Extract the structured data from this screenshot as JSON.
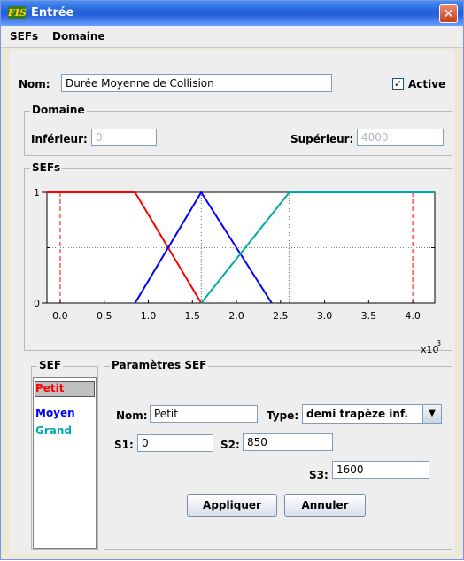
{
  "window": {
    "title": "Entrée",
    "app_icon_text": "FIS"
  },
  "menu": [
    "SEFs",
    "Domaine"
  ],
  "nom": {
    "label": "Nom:",
    "value": "Durée Moyenne de Collision"
  },
  "active": {
    "label": "Active",
    "checked": true
  },
  "domaine": {
    "group_title": "Domaine",
    "inferieur_label": "Inférieur:",
    "inferieur_value": "0",
    "superieur_label": "Supérieur:",
    "superieur_value": "4000"
  },
  "sefs_group_title": "SEFs",
  "chart_data": {
    "type": "line",
    "x_ticks": [
      "0.0",
      "0.5",
      "1.0",
      "1.5",
      "2.0",
      "2.5",
      "3.0",
      "3.5",
      "4.0"
    ],
    "y_ticks": [
      "0",
      "1"
    ],
    "multiplier_base": "x10",
    "multiplier_exp": "3",
    "xlim": [
      -0.15,
      4.25
    ],
    "ylim": [
      0,
      1
    ],
    "range_markers": [
      0,
      4.0
    ],
    "series": [
      {
        "name": "Petit",
        "color": "#ff0000",
        "points": [
          [
            -0.15,
            1
          ],
          [
            0.85,
            1
          ],
          [
            1.6,
            0
          ]
        ]
      },
      {
        "name": "Moyen",
        "color": "#0000ff",
        "points": [
          [
            0.85,
            0
          ],
          [
            1.6,
            1
          ],
          [
            2.4,
            0
          ]
        ]
      },
      {
        "name": "Grand",
        "color": "#00aaaa",
        "points": [
          [
            1.6,
            0
          ],
          [
            2.6,
            1
          ],
          [
            4.25,
            1
          ]
        ]
      }
    ]
  },
  "sef_list": {
    "title": "SEF",
    "items": [
      {
        "label": "Petit",
        "color": "#ff0000",
        "selected": true
      },
      {
        "label": "Moyen",
        "color": "#0000ff",
        "selected": false
      },
      {
        "label": "Grand",
        "color": "#00aaaa",
        "selected": false
      }
    ]
  },
  "params": {
    "title": "Paramètres SEF",
    "nom_label": "Nom:",
    "nom_value": "Petit",
    "type_label": "Type:",
    "type_value": "demi trapèze inf.",
    "s1_label": "S1:",
    "s1_value": "0",
    "s2_label": "S2:",
    "s2_value": "850",
    "s3_label": "S3:",
    "s3_value": "1600",
    "apply_label": "Appliquer",
    "cancel_label": "Annuler"
  }
}
